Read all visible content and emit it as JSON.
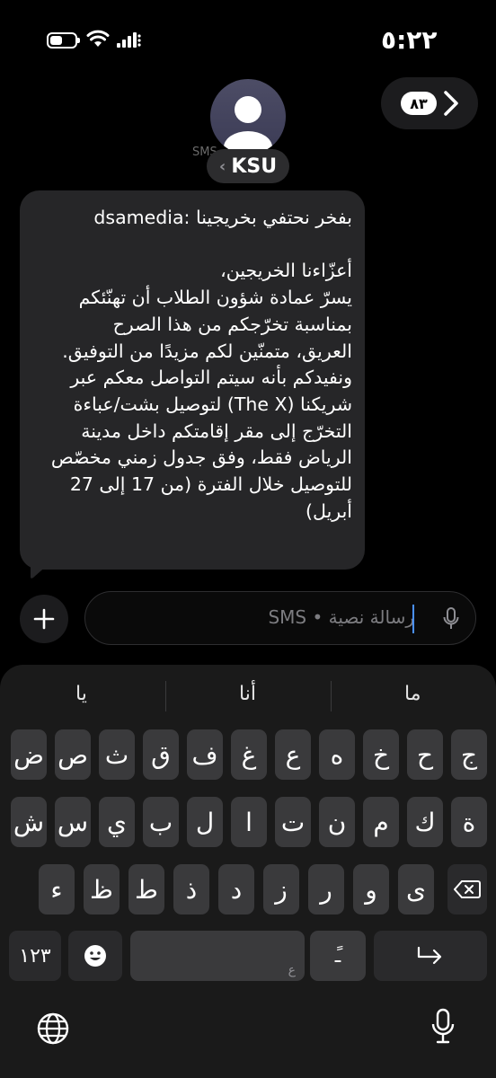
{
  "status_bar": {
    "time": "٥:٢٢"
  },
  "header": {
    "contact_name": "KSU",
    "contact_chevron": "‹",
    "sub_label": "SMS رسالة نصية",
    "unread_count": "٨٣"
  },
  "message": {
    "text": "بفخر نحتفي بخريجينا :dsamedia\n\nأعزّاءنا الخريجين،\nيسرّ عمادة شؤون الطلاب أن تهنّئكم\nبمناسبة تخرّجكم من هذا الصرح\nالعريق، متمنّين لكم مزيدًا من التوفيق.\nونفيدكم بأنه سيتم التواصل معكم عبر\nشريكنا (The X) لتوصيل بشت/عباءة\nالتخرّج إلى مقر إقامتكم داخل مدينة\nالرياض فقط، وفق جدول زمني مخصّص\nللتوصيل خلال الفترة (من 17 إلى 27\nأبريل)"
  },
  "composer": {
    "placeholder": "رسالة نصية • SMS"
  },
  "keyboard": {
    "suggestions": [
      "ما",
      "أنا",
      "يا"
    ],
    "row1": [
      "ج",
      "ح",
      "خ",
      "ه",
      "ع",
      "غ",
      "ف",
      "ق",
      "ث",
      "ص",
      "ض"
    ],
    "row2": [
      "ة",
      "ك",
      "م",
      "ن",
      "ت",
      "ا",
      "ل",
      "ب",
      "ي",
      "س",
      "ش"
    ],
    "row3": [
      "ى",
      "و",
      "ر",
      "ز",
      "د",
      "ذ",
      "ط",
      "ظ",
      "ء"
    ],
    "numbers_key": "١٢٣",
    "tanween_key": "ًـ",
    "space_hint": "ع"
  },
  "colors": {
    "background": "#000000",
    "bubble": "#262628",
    "key": "#3a3a3c",
    "caret": "#4a90ff"
  }
}
